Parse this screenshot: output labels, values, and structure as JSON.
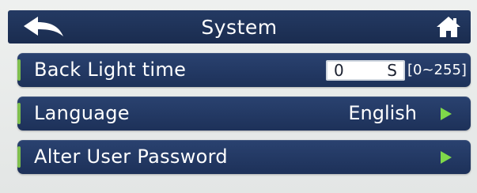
{
  "header": {
    "title": "System",
    "back_icon": "back-arrow-icon",
    "home_icon": "home-icon"
  },
  "settings": [
    {
      "label": "Back Light time",
      "value": "0",
      "unit": "S",
      "range": "[0~255]"
    },
    {
      "label": "Language",
      "value": "English",
      "icon": "play-arrow-icon"
    },
    {
      "label": "Alter User Password",
      "icon": "play-arrow-icon"
    }
  ],
  "colors": {
    "bar": "#1d3159",
    "accent_arrow": "#7fd94a",
    "text": "#ffffff",
    "background": "#e9ebea"
  }
}
